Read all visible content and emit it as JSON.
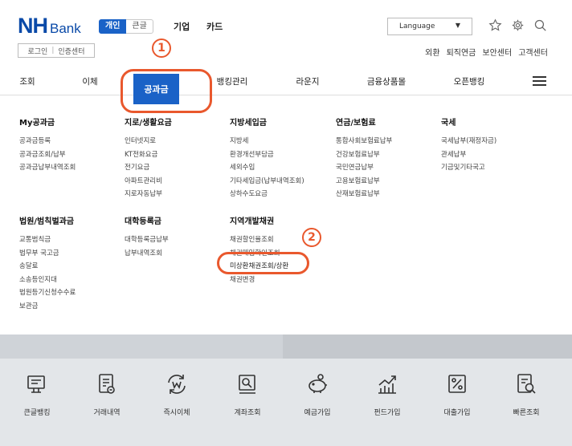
{
  "brand": {
    "nh": "NH",
    "bank": "Bank"
  },
  "segment": {
    "personal": "개인",
    "large": "큰글"
  },
  "top_links": {
    "corporate": "기업",
    "card": "카드"
  },
  "login": {
    "login": "로그인",
    "cert": "인증센터"
  },
  "language": {
    "label": "Language",
    "caret": "▼"
  },
  "utility_links": [
    "외환",
    "퇴직연금",
    "보안센터",
    "고객센터"
  ],
  "header_icons": [
    "star-icon",
    "gear-icon",
    "search-icon"
  ],
  "gnb": {
    "items": [
      "조회",
      "이체",
      "공과금",
      "뱅킹관리",
      "라운지",
      "금융상품몰",
      "오픈뱅킹"
    ],
    "active": "공과금"
  },
  "annotations": {
    "step1": "1",
    "step2": "2"
  },
  "accent_color": "#1a62c7",
  "highlight_color": "#e9582d",
  "menu": {
    "columns": [
      {
        "title": "My공과금",
        "items": [
          "공과금등록",
          "공과금조회/납부",
          "공과금납부내역조회"
        ]
      },
      {
        "title": "지로/생활요금",
        "items": [
          "인터넷지로",
          "KT전화요금",
          "전기요금",
          "아파트관리비",
          "지로자동납부"
        ]
      },
      {
        "title": "지방세입금",
        "items": [
          "지방세",
          "환경개선부담금",
          "세외수입",
          "기타세입금(납부내역조회)",
          "상하수도요금"
        ]
      },
      {
        "title": "연금/보험료",
        "items": [
          "통합사회보험료납부",
          "건강보험료납부",
          "국민연금납부",
          "고용보험료납부",
          "산재보험료납부"
        ]
      },
      {
        "title": "국세",
        "items": [
          "국세납부(재정자금)",
          "관세납부",
          "기금및기타국고"
        ]
      },
      {
        "title": "법원/범칙벌과금",
        "items": [
          "교통범칙금",
          "법무부 국고금",
          "송달료",
          "소송등인지대",
          "법원등기신청수수료",
          "보관금"
        ]
      },
      {
        "title": "대학등록금",
        "items": [
          "대학등록금납부",
          "납부내역조회"
        ]
      },
      {
        "title": "지역개발채권",
        "items": [
          "채권할인율조회",
          "채권매입확인조회",
          "미상환채권조회/상환",
          "채권변경"
        ]
      }
    ]
  },
  "quick_menu": [
    {
      "label": "큰글뱅킹",
      "icon": "large-text-banking-icon"
    },
    {
      "label": "거래내역",
      "icon": "transaction-history-icon"
    },
    {
      "label": "즉시이체",
      "icon": "instant-transfer-icon"
    },
    {
      "label": "계좌조회",
      "icon": "account-inquiry-icon"
    },
    {
      "label": "예금가입",
      "icon": "piggy-bank-icon"
    },
    {
      "label": "펀드가입",
      "icon": "fund-chart-icon"
    },
    {
      "label": "대출가입",
      "icon": "loan-percent-icon"
    },
    {
      "label": "빠른조회",
      "icon": "quick-inquiry-icon"
    }
  ]
}
